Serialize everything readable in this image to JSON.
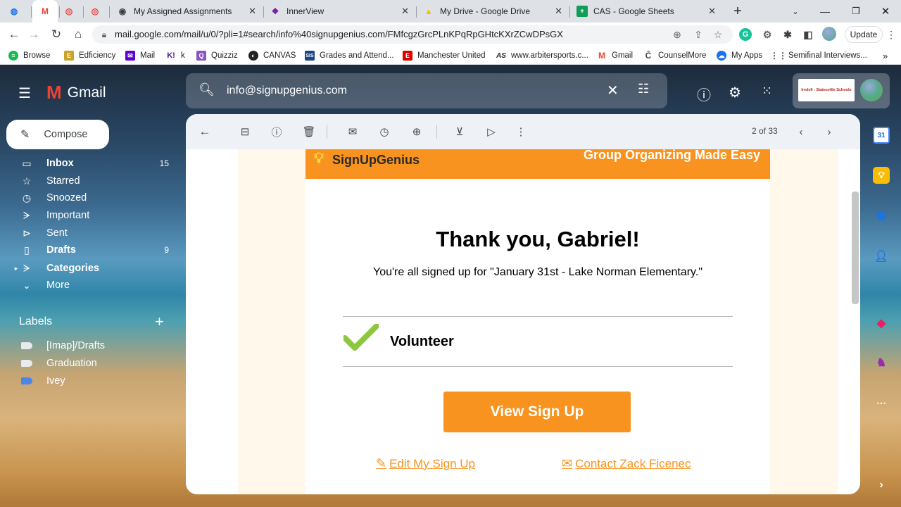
{
  "browser": {
    "tabs": [
      {
        "title": "",
        "favicon": "att-globe-icon",
        "color": "#1a73e8"
      },
      {
        "title": "",
        "favicon": "gmail-icon",
        "color": "#ea4335",
        "active": true
      },
      {
        "title": "",
        "favicon": "lifebuoy-icon",
        "color": "#e53935"
      },
      {
        "title": "",
        "favicon": "lifebuoy-icon",
        "color": "#e53935"
      },
      {
        "title": "My Assigned Assignments",
        "favicon": "globe-icon"
      },
      {
        "title": "InnerView",
        "favicon": "innerview-icon"
      },
      {
        "title": "My Drive - Google Drive",
        "favicon": "drive-icon"
      },
      {
        "title": "CAS - Google Sheets",
        "favicon": "sheets-icon"
      }
    ],
    "url": "mail.google.com/mail/u/0/?pli=1#search/info%40signupgenius.com/FMfcgzGrcPLnKPqRpGHtcKXrZCwDPsGX",
    "update_label": "Update",
    "bookmarks": [
      {
        "label": "Browse",
        "icon": "spotify-icon",
        "color": "#1db954"
      },
      {
        "label": "Edficiency",
        "icon": "edficiency-icon",
        "color": "#c9a227"
      },
      {
        "label": "Mail",
        "icon": "yahoo-mail-icon",
        "color": "#6001d2"
      },
      {
        "label": "k",
        "icon": "kahoot-icon",
        "color": "#46178f"
      },
      {
        "label": "Quizziz",
        "icon": "quizizz-icon",
        "color": "#8854c0"
      },
      {
        "label": "CANVAS",
        "icon": "globe-icon",
        "color": "#202124"
      },
      {
        "label": "Grades and Attend...",
        "icon": "sis-icon",
        "color": "#1c4587"
      },
      {
        "label": "Manchester United",
        "icon": "espn-icon",
        "color": "#d00"
      },
      {
        "label": "www.arbitersports.c...",
        "icon": "arbiter-icon",
        "color": "#202124"
      },
      {
        "label": "Gmail",
        "icon": "gmail-icon",
        "color": "#ea4335"
      },
      {
        "label": "CounselMore",
        "icon": "counselmore-icon",
        "color": "#444"
      },
      {
        "label": "My Apps",
        "icon": "cloud-icon",
        "color": "#1a73e8"
      },
      {
        "label": "Semifinal Interviews...",
        "icon": "grid-icon",
        "color": "#444"
      }
    ]
  },
  "gmail": {
    "app_name": "Gmail",
    "search_value": "info@signupgenius.com",
    "compose_label": "Compose",
    "nav": [
      {
        "label": "Inbox",
        "count": "15",
        "icon": "inbox-icon",
        "bold": true
      },
      {
        "label": "Starred",
        "count": "",
        "icon": "star-icon",
        "bold": false
      },
      {
        "label": "Snoozed",
        "count": "",
        "icon": "clock-icon",
        "bold": false
      },
      {
        "label": "Important",
        "count": "",
        "icon": "important-icon",
        "bold": false
      },
      {
        "label": "Sent",
        "count": "",
        "icon": "send-icon",
        "bold": false
      },
      {
        "label": "Drafts",
        "count": "9",
        "icon": "draft-icon",
        "bold": true
      },
      {
        "label": "Categories",
        "count": "",
        "icon": "label-icon",
        "bold": true
      },
      {
        "label": "More",
        "count": "",
        "icon": "chevron-down-icon",
        "bold": false
      }
    ],
    "labels_title": "Labels",
    "labels": [
      {
        "label": "[Imap]/Drafts",
        "color": "#e8eaed"
      },
      {
        "label": "Graduation",
        "color": "#e8eaed"
      },
      {
        "label": "Ivey",
        "color": "#4a86e8"
      }
    ],
    "pager": "2 of 33",
    "workspace_logo_text": "Iredell - Statesville Schools"
  },
  "email": {
    "brand": "SignUpGenius",
    "tagline": "Group Organizing Made Easy",
    "heading": "Thank you, Gabriel!",
    "message": "You're all signed up for \"January 31st - Lake Norman Elementary.\"",
    "role": "Volunteer",
    "view_button": "View Sign Up",
    "edit_link": "Edit My Sign Up",
    "contact_link": "Contact Zack Ficenec",
    "accent_color": "#f7931e",
    "check_color": "#8dc63f"
  }
}
